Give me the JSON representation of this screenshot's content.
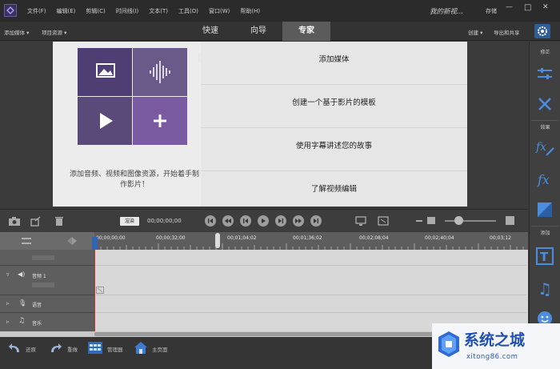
{
  "titlebar": {
    "menu": [
      "文件(F)",
      "编辑(E)",
      "剪辑(C)",
      "时间线(I)",
      "文本(T)",
      "工具(O)",
      "窗口(W)",
      "帮助(H)"
    ],
    "doc_title": "我的新视...",
    "save": "存储",
    "minimize_glyph": "—",
    "maximize_glyph": "□",
    "close_glyph": "✕"
  },
  "toolbar": {
    "add_media": "添加媒体 ▾",
    "project_assets": "项目资源 ▾",
    "modes": [
      "快速",
      "向导",
      "专家"
    ],
    "active_mode": "专家",
    "create": "创建 ▾",
    "share": "导出和共享"
  },
  "welcome": {
    "description": "添加音频、视频和图像资源，开始着手制作影片！",
    "options": [
      "添加媒体",
      "创建一个基于影片的模板",
      "使用字幕讲述您的故事",
      "了解视频编辑"
    ],
    "tile_colors": [
      "#4f3e74",
      "#6a5a8a",
      "#5a4a7a",
      "#7a5aa0"
    ]
  },
  "right_panel": {
    "sections": [
      {
        "label": "修正",
        "icons": [
          "adjust-icon",
          "tools-icon"
        ]
      },
      {
        "label": "效果",
        "icons": [
          "fx-edit-icon",
          "fx-icon",
          "color-icon"
        ]
      },
      {
        "label": "添加",
        "icons": [
          "title-icon",
          "music-icon",
          "emoji-icon"
        ]
      }
    ]
  },
  "transport": {
    "render_label": "渲染",
    "timecode": "00;00;00;00"
  },
  "timeline": {
    "ruler": [
      "00;00;00;00",
      "00;00;32;00",
      "00;01;04;02",
      "00;01;36;02",
      "00;02;08;04",
      "00;02;40;04",
      "00;03;12"
    ],
    "tracks": [
      "音频 1",
      "语音",
      "音乐"
    ]
  },
  "bottombar": {
    "undo": "还原",
    "redo": "重做",
    "organizer": "管理器",
    "home": "主页面"
  },
  "watermark": {
    "text": "系统之城",
    "url": "xitong86.com"
  },
  "colors": {
    "accent": "#2f5d96",
    "playhead": "#c8302c",
    "tile_purple": "#6b4c9a"
  }
}
